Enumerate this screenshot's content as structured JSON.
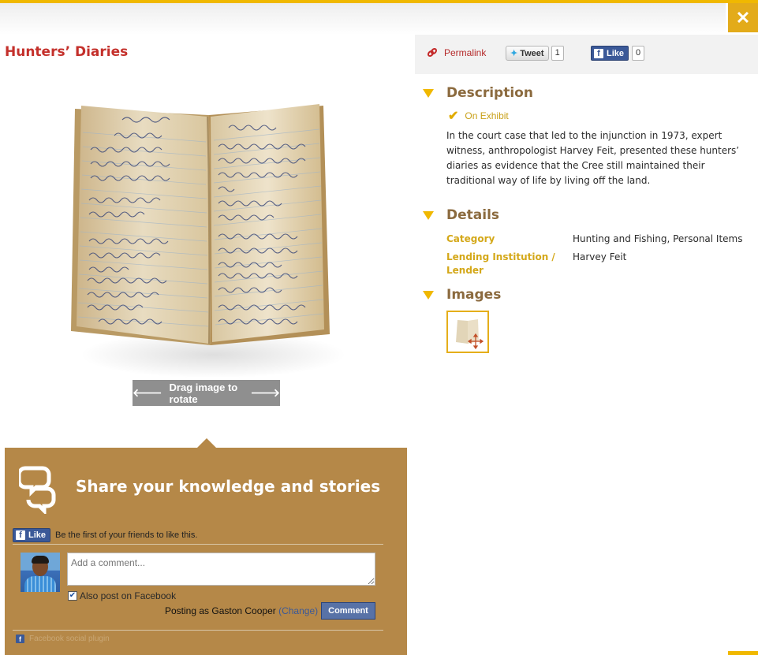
{
  "header": {
    "close_icon": "close-icon",
    "accent_color": "#f0b800"
  },
  "item": {
    "title": "Hunters’ Diaries"
  },
  "viewer": {
    "rotate_label": "Drag image to rotate",
    "left_icon": "arrow-left-icon",
    "right_icon": "arrow-right-icon"
  },
  "social": {
    "permalink_label": "Permalink",
    "tweet_label": "Tweet",
    "tweet_count": "1",
    "like_label": "Like",
    "like_count": "0"
  },
  "description": {
    "heading": "Description",
    "status": "On Exhibit",
    "text": "In the court case that led to the injunction in 1973, expert witness, anthropologist Harvey Feit, presented these hunters’ diaries as evidence that the Cree still maintained their traditional way of life by living off the land."
  },
  "details": {
    "heading": "Details",
    "rows": [
      {
        "label": "Category",
        "value": "Hunting and Fishing, Personal Items"
      },
      {
        "label": "Lending Institution / Lender",
        "value": "Harvey Feit"
      }
    ]
  },
  "images": {
    "heading": "Images"
  },
  "share": {
    "title": "Share your knowledge and stories",
    "like_label": "Like",
    "like_text": "Be the first of your friends to like this.",
    "comment_placeholder": "Add a comment...",
    "also_post_label": "Also post on Facebook",
    "posting_as": "Posting as Gaston Cooper",
    "change_label": "(Change)",
    "comment_button": "Comment",
    "plugin_label": "Facebook social plugin",
    "panel_color": "#b58848"
  }
}
